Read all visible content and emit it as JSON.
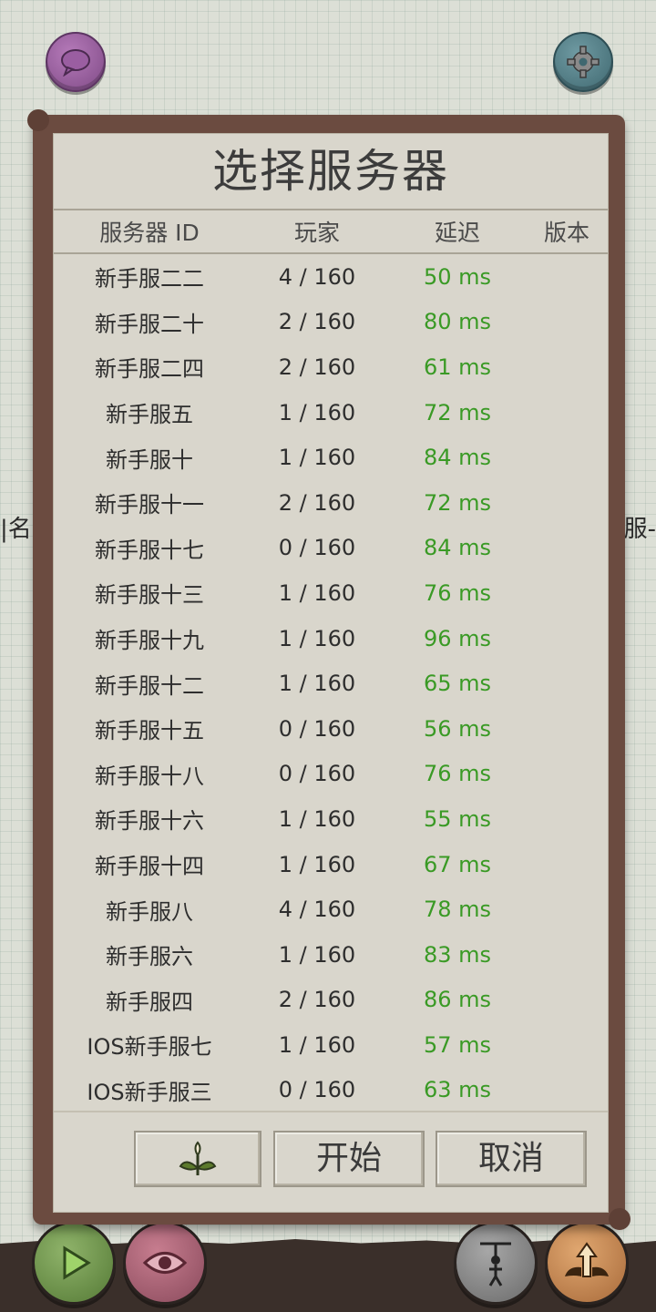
{
  "background": {
    "left_text": "|名字",
    "right_text": "服-"
  },
  "top_buttons": {
    "chat_icon": "speech-bubble-icon",
    "settings_icon": "gear-icon"
  },
  "dialog": {
    "title": "选择服务器",
    "headers": {
      "id": "服务器 ID",
      "players": "玩家",
      "ping": "延迟",
      "version": "版本"
    },
    "servers": [
      {
        "name": "新手服二二",
        "players": "4 / 160",
        "ping": "50 ms",
        "version": ""
      },
      {
        "name": "新手服二十",
        "players": "2 / 160",
        "ping": "80 ms",
        "version": ""
      },
      {
        "name": "新手服二四",
        "players": "2 / 160",
        "ping": "61 ms",
        "version": ""
      },
      {
        "name": "新手服五",
        "players": "1 / 160",
        "ping": "72 ms",
        "version": ""
      },
      {
        "name": "新手服十",
        "players": "1 / 160",
        "ping": "84 ms",
        "version": ""
      },
      {
        "name": "新手服十一",
        "players": "2 / 160",
        "ping": "72 ms",
        "version": ""
      },
      {
        "name": "新手服十七",
        "players": "0 / 160",
        "ping": "84 ms",
        "version": ""
      },
      {
        "name": "新手服十三",
        "players": "1 / 160",
        "ping": "76 ms",
        "version": ""
      },
      {
        "name": "新手服十九",
        "players": "1 / 160",
        "ping": "96 ms",
        "version": ""
      },
      {
        "name": "新手服十二",
        "players": "1 / 160",
        "ping": "65 ms",
        "version": ""
      },
      {
        "name": "新手服十五",
        "players": "0 / 160",
        "ping": "56 ms",
        "version": ""
      },
      {
        "name": "新手服十八",
        "players": "0 / 160",
        "ping": "76 ms",
        "version": ""
      },
      {
        "name": "新手服十六",
        "players": "1 / 160",
        "ping": "55 ms",
        "version": ""
      },
      {
        "name": "新手服十四",
        "players": "1 / 160",
        "ping": "67 ms",
        "version": ""
      },
      {
        "name": "新手服八",
        "players": "4 / 160",
        "ping": "78 ms",
        "version": ""
      },
      {
        "name": "新手服六",
        "players": "1 / 160",
        "ping": "83 ms",
        "version": ""
      },
      {
        "name": "新手服四",
        "players": "2 / 160",
        "ping": "86 ms",
        "version": ""
      },
      {
        "name": "IOS新手服七",
        "players": "1 / 160",
        "ping": "57 ms",
        "version": ""
      },
      {
        "name": "IOS新手服三",
        "players": "0 / 160",
        "ping": "63 ms",
        "version": ""
      }
    ],
    "buttons": {
      "plant_icon": "plant-sprout-icon",
      "start": "开始",
      "cancel": "取消"
    }
  },
  "bottom_buttons": [
    "play-icon",
    "eye-icon",
    "puppet-icon",
    "wings-arrow-icon"
  ],
  "colors": {
    "ping": "#3a9a25",
    "dialog_bg": "#d9d6cc",
    "frame": "#6b4b40"
  }
}
